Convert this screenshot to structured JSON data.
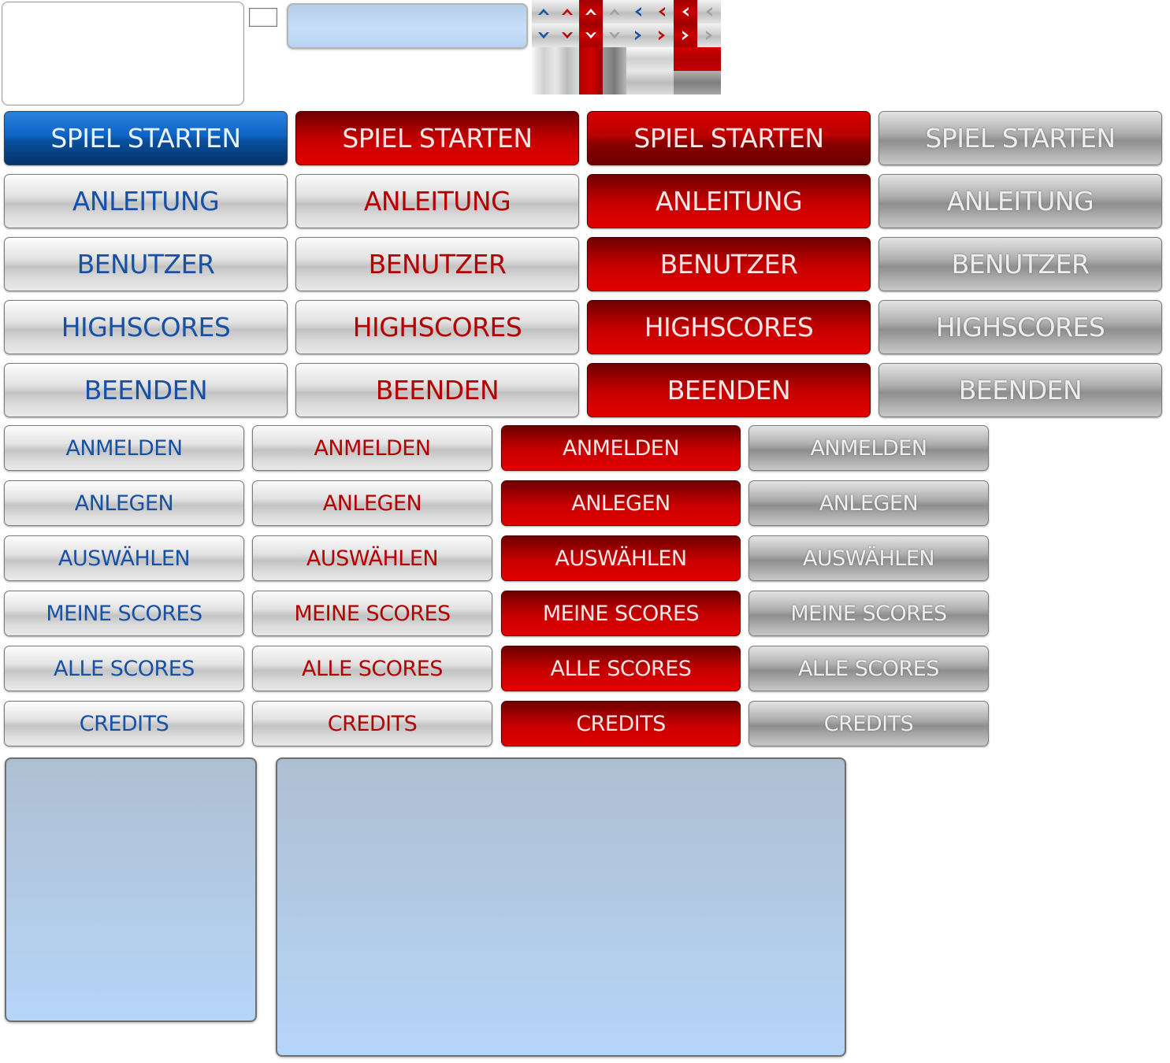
{
  "menu_buttons": {
    "blue": [
      "SPIEL STARTEN",
      "ANLEITUNG",
      "BENUTZER",
      "HIGHSCORES",
      "BEENDEN"
    ],
    "red_on_light": [
      "SPIEL STARTEN",
      "ANLEITUNG",
      "BENUTZER",
      "HIGHSCORES",
      "BEENDEN"
    ],
    "red": [
      "SPIEL STARTEN",
      "ANLEITUNG",
      "BENUTZER",
      "HIGHSCORES",
      "BEENDEN"
    ],
    "disabled": [
      "SPIEL STARTEN",
      "ANLEITUNG",
      "BENUTZER",
      "HIGHSCORES",
      "BEENDEN"
    ]
  },
  "sub_buttons": {
    "blue": [
      "ANMELDEN",
      "ANLEGEN",
      "AUSWÄHLEN",
      "MEINE SCORES",
      "ALLE SCORES",
      "CREDITS"
    ],
    "red_on_light": [
      "ANMELDEN",
      "ANLEGEN",
      "AUSWÄHLEN",
      "MEINE SCORES",
      "ALLE SCORES",
      "CREDITS"
    ],
    "red": [
      "ANMELDEN",
      "ANLEGEN",
      "AUSWÄHLEN",
      "MEINE SCORES",
      "ALLE SCORES",
      "CREDITS"
    ],
    "disabled": [
      "ANMELDEN",
      "ANLEGEN",
      "AUSWÄHLEN",
      "MEINE SCORES",
      "ALLE SCORES",
      "CREDITS"
    ]
  },
  "sprite_icons": [
    "arrow-up-icon",
    "arrow-down-icon",
    "arrow-left-icon",
    "arrow-right-icon"
  ],
  "colors": {
    "accent_blue": "#1751a6",
    "accent_red": "#b50000",
    "panel": "#b3cbe6"
  }
}
